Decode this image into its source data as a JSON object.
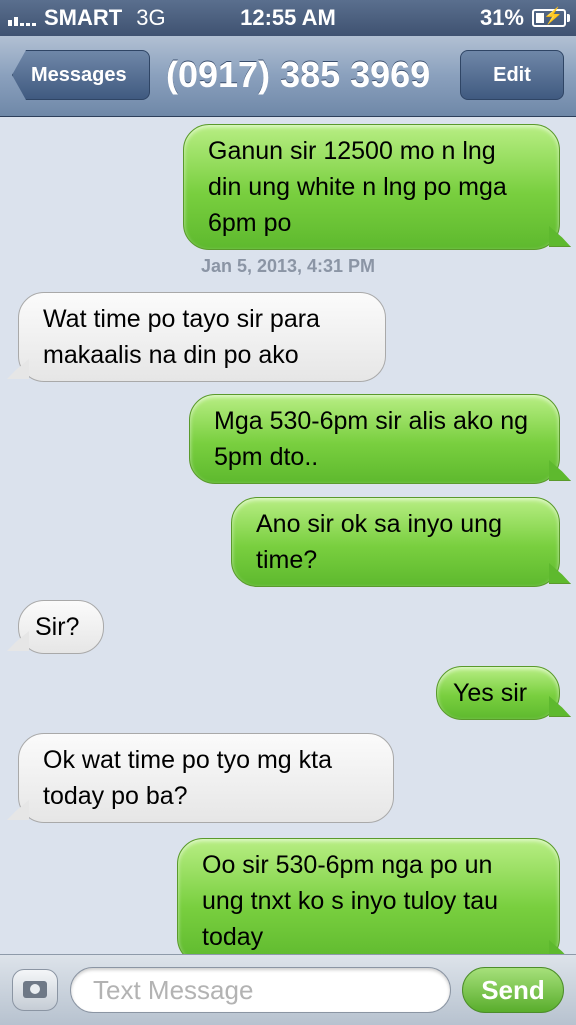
{
  "status_bar": {
    "carrier": "SMART",
    "network": "3G",
    "time": "12:55 AM",
    "battery_label": "31%",
    "battery_level": 0.31,
    "signal_bars": 2
  },
  "nav": {
    "back_label": "Messages",
    "title": "(0917) 385 3969",
    "edit_label": "Edit"
  },
  "messages": [
    {
      "direction": "outgoing",
      "text": "Ganun sir 12500 mo n lng din ung white n lng po mga 6pm po"
    },
    {
      "direction": "incoming",
      "text": "Wat time po tayo sir para makaalis na din po ako"
    },
    {
      "direction": "outgoing",
      "text": "Mga 530-6pm sir alis ako ng 5pm dto.."
    },
    {
      "direction": "outgoing",
      "text": "Ano sir ok sa inyo ung time?"
    },
    {
      "direction": "incoming",
      "text": "Sir?"
    },
    {
      "direction": "outgoing",
      "text": "Yes sir"
    },
    {
      "direction": "incoming",
      "text": "Ok wat time po tyo mg kta today po ba?"
    },
    {
      "direction": "outgoing",
      "text": "Oo sir 530-6pm nga po un ung tnxt ko s inyo tuloy tau today"
    }
  ],
  "timestamp": "Jan 5, 2013, 4:31 PM",
  "input": {
    "placeholder": "Text Message",
    "value": "",
    "send_label": "Send"
  },
  "colors": {
    "outgoing_bubble": "#79cf3f",
    "incoming_bubble": "#e6e6e6",
    "background": "#dbe2ed",
    "nav_bar": "#8aa0bd"
  }
}
